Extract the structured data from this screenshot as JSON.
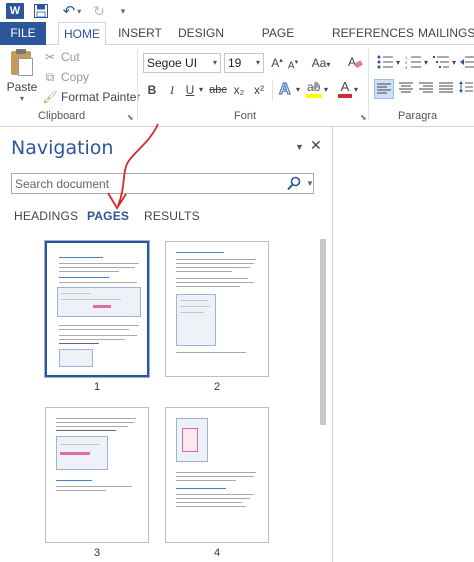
{
  "app": {
    "logo_letter": "W"
  },
  "tabs": {
    "file": "FILE",
    "home": "HOME",
    "insert": "INSERT",
    "design": "DESIGN",
    "page_layout": "PAGE LAYOUT",
    "references": "REFERENCES",
    "mailings": "MAILINGS"
  },
  "ribbon": {
    "clipboard": {
      "paste": "Paste",
      "cut": "Cut",
      "copy": "Copy",
      "format_painter": "Format Painter",
      "label": "Clipboard"
    },
    "font": {
      "font_name": "Segoe UI",
      "font_size": "19",
      "label": "Font",
      "bold": "B",
      "italic": "I",
      "underline": "U",
      "strikethrough": "abc",
      "subscript": "x₂",
      "superscript": "x²",
      "change_case": "Aa",
      "font_color_letter": "A"
    },
    "paragraph": {
      "label": "Paragra"
    }
  },
  "navigation": {
    "title": "Navigation",
    "search_placeholder": "Search document",
    "tabs": {
      "headings": "HEADINGS",
      "pages": "PAGES",
      "results": "RESULTS"
    },
    "pages": [
      {
        "number": "1",
        "selected": true
      },
      {
        "number": "2",
        "selected": false
      },
      {
        "number": "3",
        "selected": false
      },
      {
        "number": "4",
        "selected": false
      }
    ]
  },
  "colors": {
    "accent": "#2b579a",
    "annotation": "#d42a2a"
  },
  "icons": {
    "save": "save-icon",
    "undo": "undo-icon",
    "redo": "redo-icon",
    "search": "search-icon",
    "close": "close-icon"
  }
}
